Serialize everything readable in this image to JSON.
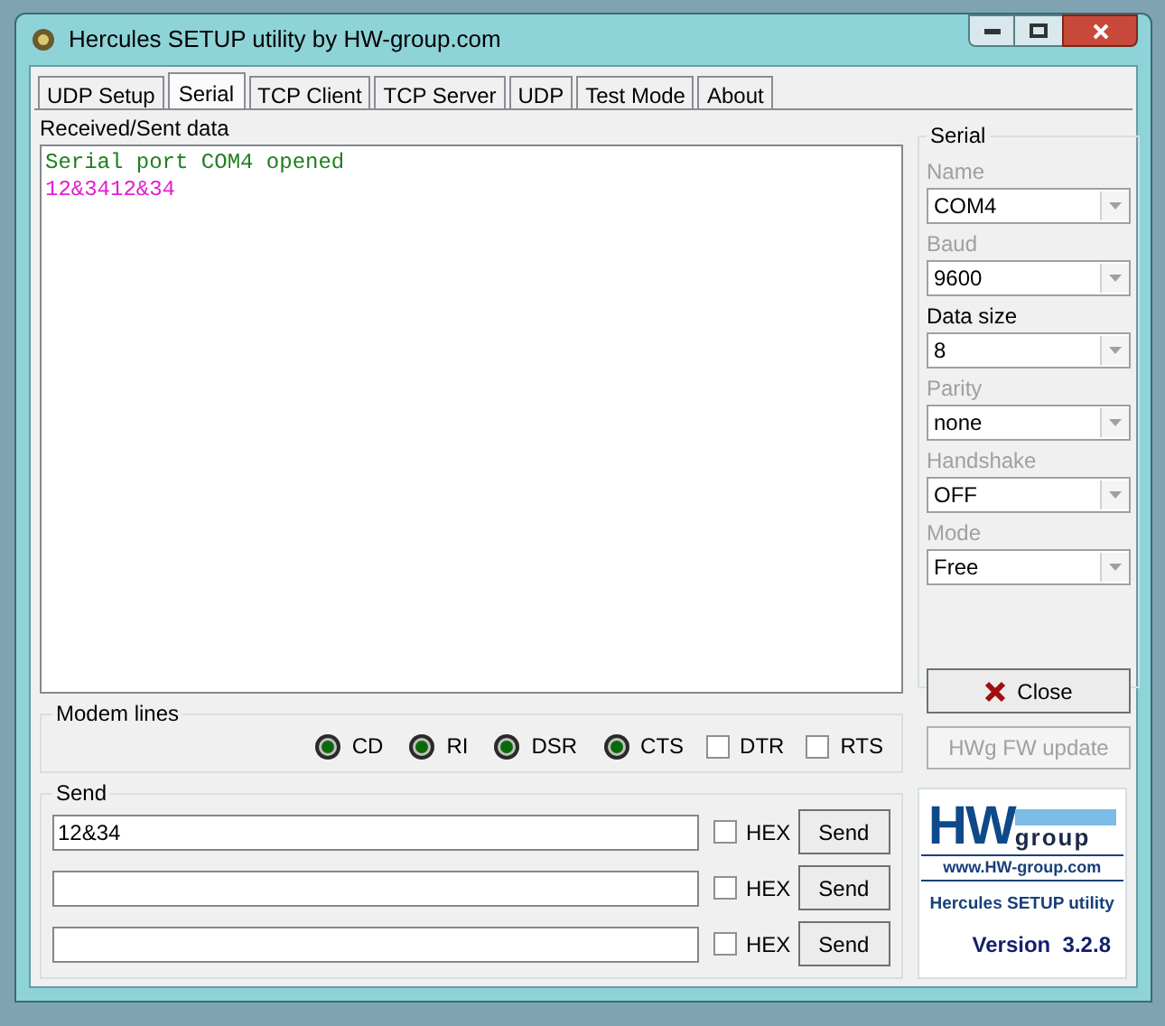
{
  "window": {
    "title": "Hercules SETUP utility by HW-group.com"
  },
  "tabs": [
    {
      "label": "UDP Setup",
      "selected": false
    },
    {
      "label": "Serial",
      "selected": true
    },
    {
      "label": "TCP Client",
      "selected": false
    },
    {
      "label": "TCP Server",
      "selected": false
    },
    {
      "label": "UDP",
      "selected": false
    },
    {
      "label": "Test Mode",
      "selected": false
    },
    {
      "label": "About",
      "selected": false
    }
  ],
  "received": {
    "label": "Received/Sent data",
    "lines": [
      {
        "kind": "status",
        "text": "Serial port COM4 opened"
      },
      {
        "kind": "data",
        "text": "12&3412&34"
      }
    ]
  },
  "serial": {
    "title": "Serial",
    "fields": [
      {
        "label": "Name",
        "value": "COM4",
        "disabled": true
      },
      {
        "label": "Baud",
        "value": "9600",
        "disabled": true
      },
      {
        "label": "Data size",
        "value": "8",
        "disabled": false
      },
      {
        "label": "Parity",
        "value": "none",
        "disabled": true
      },
      {
        "label": "Handshake",
        "value": "OFF",
        "disabled": true
      },
      {
        "label": "Mode",
        "value": "Free",
        "disabled": true
      }
    ],
    "close_button": "Close",
    "fw_button": {
      "label": "HWg FW update",
      "disabled": true
    }
  },
  "modem_lines": {
    "title": "Modem lines",
    "items": [
      {
        "kind": "led",
        "label": "CD",
        "on": true
      },
      {
        "kind": "led",
        "label": "RI",
        "on": true
      },
      {
        "kind": "led",
        "label": "DSR",
        "on": true
      },
      {
        "kind": "led",
        "label": "CTS",
        "on": true
      },
      {
        "kind": "checkbox",
        "label": "DTR",
        "checked": false
      },
      {
        "kind": "checkbox",
        "label": "RTS",
        "checked": false
      }
    ]
  },
  "send": {
    "title": "Send",
    "rows": [
      {
        "value": "12&34",
        "hex_label": "HEX",
        "hex": false,
        "button": "Send"
      },
      {
        "value": "",
        "hex_label": "HEX",
        "hex": false,
        "button": "Send"
      },
      {
        "value": "",
        "hex_label": "HEX",
        "hex": false,
        "button": "Send"
      }
    ]
  },
  "logo": {
    "brand": "HW",
    "group": "group",
    "url": "www.HW-group.com",
    "product": "Hercules SETUP utility",
    "version": "Version  3.2.8"
  }
}
